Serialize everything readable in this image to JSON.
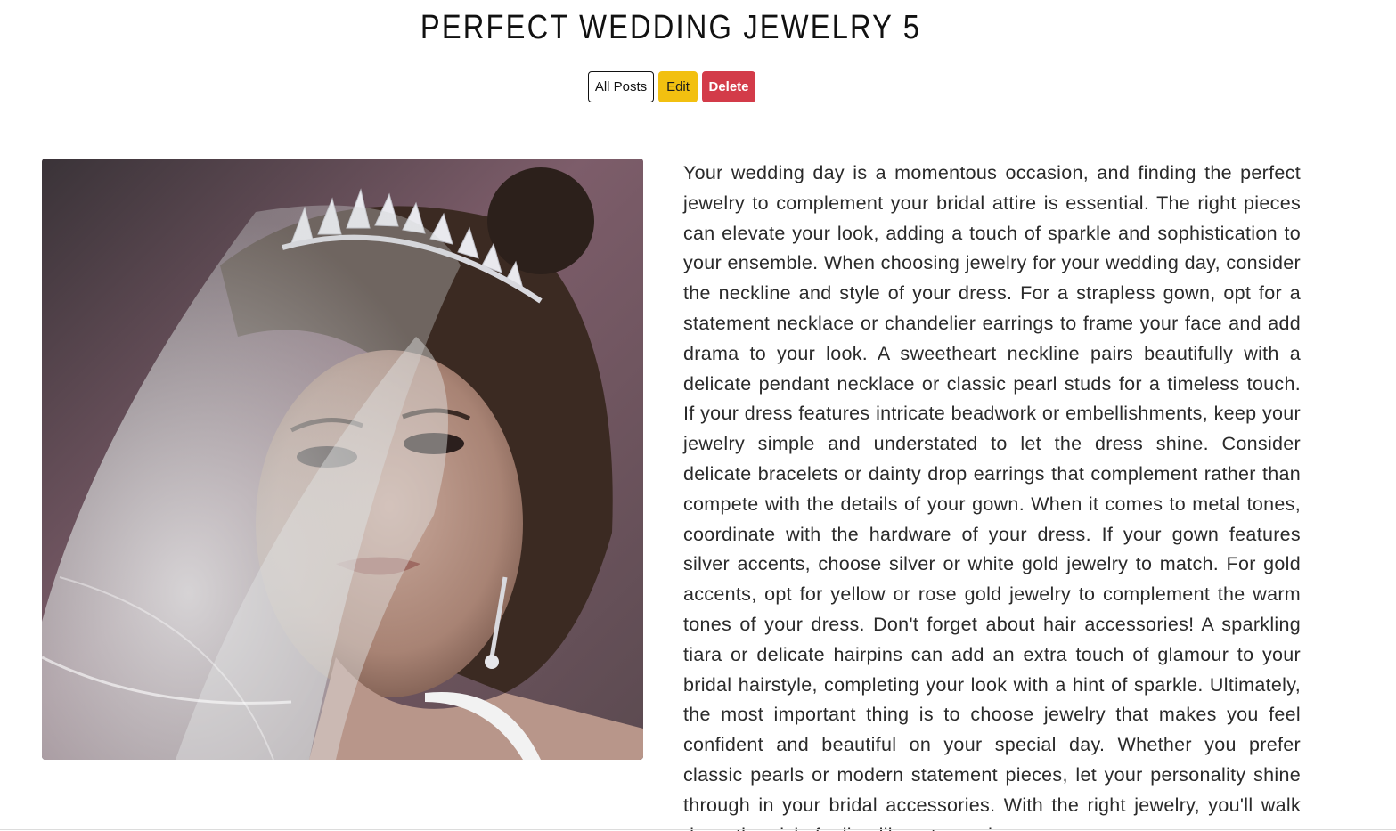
{
  "post": {
    "title": "PERFECT WEDDING JEWELRY 5",
    "body": "Your wedding day is a momentous occasion, and finding the perfect jewelry to complement your bridal attire is essential. The right pieces can elevate your look, adding a touch of sparkle and sophistication to your ensemble. When choosing jewelry for your wedding day, consider the neckline and style of your dress. For a strapless gown, opt for a statement necklace or chandelier earrings to frame your face and add drama to your look. A sweetheart neckline pairs beautifully with a delicate pendant necklace or classic pearl studs for a timeless touch. If your dress features intricate beadwork or embellishments, keep your jewelry simple and understated to let the dress shine. Consider delicate bracelets or dainty drop earrings that complement rather than compete with the details of your gown. When it comes to metal tones, coordinate with the hardware of your dress. If your gown features silver accents, choose silver or white gold jewelry to match. For gold accents, opt for yellow or rose gold jewelry to complement the warm tones of your dress. Don't forget about hair accessories! A sparkling tiara or delicate hairpins can add an extra touch of glamour to your bridal hairstyle, completing your look with a hint of sparkle. Ultimately, the most important thing is to choose jewelry that makes you feel confident and beautiful on your special day. Whether you prefer classic pearls or modern statement pieces, let your personality shine through in your bridal accessories. With the right jewelry, you'll walk down the aisle feeling like a true princess."
  },
  "actions": {
    "all_posts_label": "All Posts",
    "edit_label": "Edit",
    "delete_label": "Delete"
  },
  "colors": {
    "edit_button": "#f2c010",
    "delete_button": "#d33b49"
  }
}
